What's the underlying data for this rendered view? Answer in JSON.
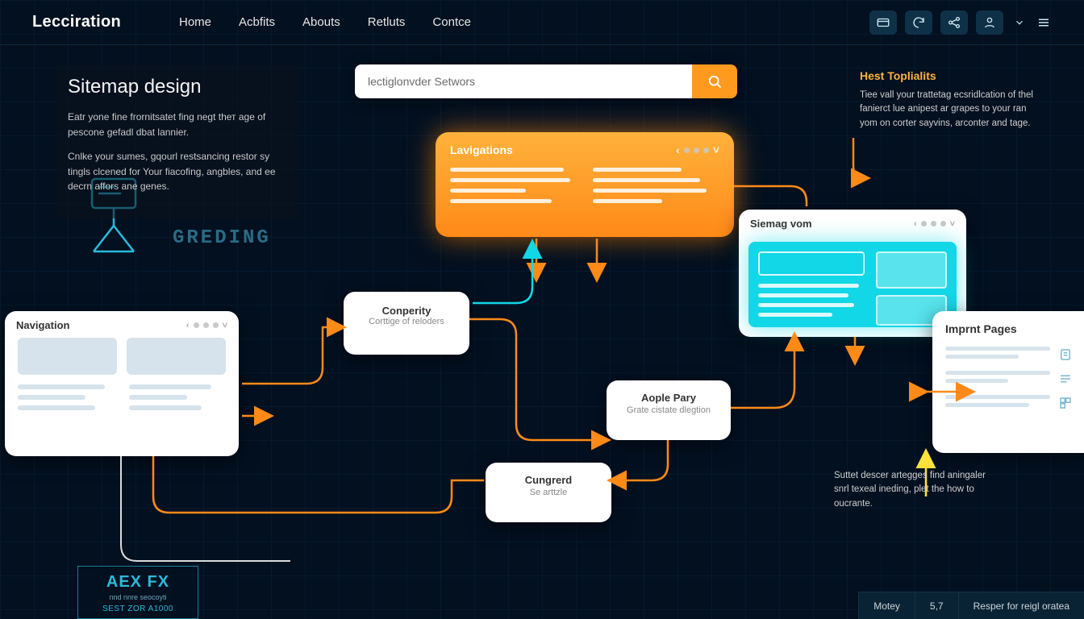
{
  "header": {
    "brand": "Lecciration",
    "nav": [
      "Home",
      "Acbfits",
      "Abouts",
      "Retluts",
      "Contce"
    ]
  },
  "left_panel": {
    "title": "Sitemap design",
    "p1": "Eatr yone fine frornitsatet fing negt thет age of pescone gefadl dbat lannier.",
    "p2": "Cnlke your sumes, gqourl restsancing restor sy tingls clcened for Your fiacofing, angbles, and ee decrn affors ane genes."
  },
  "search": {
    "value": "lectiglonvder Setwors"
  },
  "right_panel": {
    "title": "Hest Toplialits",
    "p": "Tiee vall your trattetag ecsridlcation of thel fanierct lue anipest ar grapes to your ran yom on corter sayvins, arconter and tage."
  },
  "right_low": "Suttet descer artegges find aningaler snrl texeal ineding, plet the how to oucrante.",
  "nodes": {
    "lavigations": "Lavigations",
    "conperity": {
      "t": "Conperity",
      "s": "Corttige of reloders"
    },
    "aople": {
      "t": "Aople Pary",
      "s": "Grate cistate dlegtion"
    },
    "cungrerd": {
      "t": "Cungrerd",
      "s": "Se arttzle"
    },
    "siemag": "Siemag vom",
    "navigation": "Navigation",
    "imprint": "Imprnt Pages"
  },
  "greding": "GREDING",
  "poster": {
    "big": "AEX FX",
    "s1": "nnd nnre seocoyti",
    "s2": "SEST ZOR A1000"
  },
  "footer": {
    "a": "Motey",
    "b": "5,7",
    "c": "Resper for reigl orateа"
  }
}
